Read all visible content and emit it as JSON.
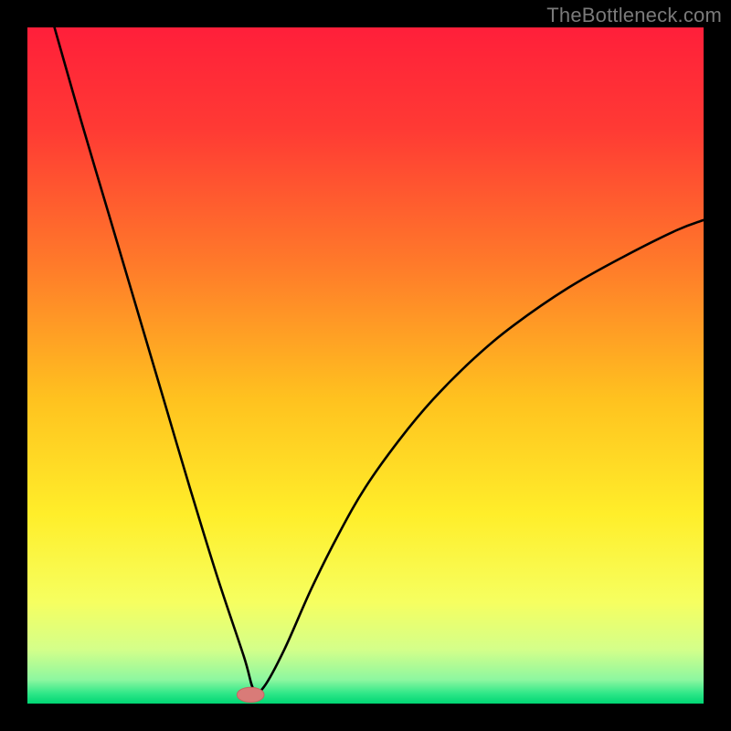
{
  "watermark": "TheBottleneck.com",
  "colors": {
    "black": "#000000",
    "curve": "#000000",
    "marker_fill": "#d97b78",
    "marker_stroke": "#c96360"
  },
  "chart_data": {
    "type": "line",
    "title": "",
    "xlabel": "",
    "ylabel": "",
    "xlim": [
      0,
      100
    ],
    "ylim": [
      0,
      100
    ],
    "gradient_stops": [
      {
        "offset": 0.0,
        "color": "#ff1f3a"
      },
      {
        "offset": 0.15,
        "color": "#ff3a34"
      },
      {
        "offset": 0.35,
        "color": "#ff7a2a"
      },
      {
        "offset": 0.55,
        "color": "#ffc21f"
      },
      {
        "offset": 0.72,
        "color": "#ffee2a"
      },
      {
        "offset": 0.85,
        "color": "#f6ff60"
      },
      {
        "offset": 0.92,
        "color": "#d4ff8a"
      },
      {
        "offset": 0.965,
        "color": "#8cf7a0"
      },
      {
        "offset": 0.985,
        "color": "#2fe788"
      },
      {
        "offset": 1.0,
        "color": "#00d673"
      }
    ],
    "series": [
      {
        "name": "bottleneck-curve",
        "x": [
          4,
          8,
          12,
          16,
          20,
          24,
          28,
          32,
          33.5,
          35,
          38,
          42,
          46,
          50,
          55,
          60,
          66,
          72,
          80,
          88,
          96,
          100
        ],
        "y": [
          100,
          86,
          72.5,
          59,
          45.5,
          32,
          19,
          7,
          2,
          2.5,
          8,
          17,
          25,
          32,
          39,
          45,
          51,
          56,
          61.5,
          66,
          70,
          71.5
        ]
      }
    ],
    "marker": {
      "x": 33,
      "y": 1.3,
      "rx": 2.0,
      "ry": 1.1
    }
  }
}
